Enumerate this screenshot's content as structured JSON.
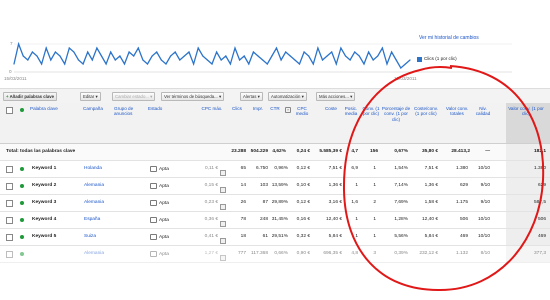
{
  "chart": {
    "y_top_label": "7",
    "y_bottom_label": "0",
    "date_start": "15/03/2011",
    "date_end": "15/03/2011",
    "history_link": "Ver mi historial de cambios",
    "legend_label": "Clics (1 por clic)",
    "line_color": "#2c74c9"
  },
  "chart_data": {
    "type": "line",
    "series": [
      {
        "name": "Clics (1 por clic)",
        "values": [
          2,
          7,
          4,
          3,
          5,
          4,
          2,
          6,
          3,
          5,
          4,
          2,
          6,
          5,
          3,
          2,
          5,
          3,
          6,
          4,
          2,
          5,
          3,
          4,
          2,
          5,
          4,
          6,
          3,
          2,
          4,
          5,
          3,
          2,
          4,
          5,
          3,
          4,
          5,
          2,
          6,
          4,
          3,
          2,
          5,
          3,
          4,
          2,
          6,
          3,
          4,
          2,
          5,
          4,
          3,
          2,
          4,
          6,
          3,
          5,
          4,
          3,
          2,
          5,
          4,
          2,
          6,
          3,
          4,
          5,
          2,
          6,
          4,
          3,
          5,
          4,
          2,
          5,
          3,
          4,
          6,
          2,
          5,
          3,
          1,
          2,
          3
        ]
      }
    ],
    "ylim": [
      0,
      7
    ],
    "xlabel": "",
    "ylabel": ""
  },
  "toolbar": {
    "add_keywords": "Añadir palabras clave",
    "edit": "Editar",
    "change_status": "Cambiar estado...",
    "search_terms": "Ver términos de búsqueda...",
    "alerts": "Alertas",
    "automation": "Automatización",
    "more_actions": "Más acciones..."
  },
  "columns": {
    "keyword": "Palabra clave",
    "campaign": "Campaña",
    "ad_group": "Grupo de anuncios",
    "status": "Estado",
    "max_cpc": "CPC máx.",
    "clicks": "Clics",
    "impr": "Impr.",
    "ctr": "CTR",
    "avg_cpc": "CPC medio",
    "cost": "Coste",
    "avg_pos": "Posic. media",
    "conv": "Conv. (1 por clic)",
    "conv_rate": "Porcentaje de conv. (1 por clic)",
    "cost_conv": "Coste/conv. (1 por clic)",
    "total_conv_value": "Valor conv. totales",
    "quality": "Niv. calidad",
    "conv_value": "Valor conv. (1 por clic)"
  },
  "total_row": {
    "label": "Total: todas las palabras clave",
    "clicks": "23.288",
    "impr": "504.229",
    "ctr": "4,62%",
    "avg_cpc": "0,24 €",
    "cost": "5.585,39 €",
    "avg_pos": "4,7",
    "conv": "156",
    "conv_rate": "0,67%",
    "cost_conv": "35,80 €",
    "total_conv_value": "28.413,2",
    "quality": "—",
    "conv_value": "182,1"
  },
  "rows": [
    {
      "keyword": "Keyword 1",
      "campaign": "Holanda",
      "status": "Apta",
      "max_cpc": "0,11 €",
      "clicks": "65",
      "impr": "6.750",
      "ctr": "0,96%",
      "avg_cpc": "0,12 €",
      "cost": "7,51 €",
      "avg_pos": "6,9",
      "conv": "1",
      "conv_rate": "1,54%",
      "cost_conv": "7,51 €",
      "total_conv_value": "1.380",
      "quality": "10/10",
      "conv_value": "1.380"
    },
    {
      "keyword": "Keyword 2",
      "campaign": "Alemania",
      "status": "Apta",
      "max_cpc": "0,15 €",
      "clicks": "14",
      "impr": "103",
      "ctr": "13,59%",
      "avg_cpc": "0,10 €",
      "cost": "1,36 €",
      "avg_pos": "1",
      "conv": "1",
      "conv_rate": "7,14%",
      "cost_conv": "1,36 €",
      "total_conv_value": "629",
      "quality": "9/10",
      "conv_value": "629"
    },
    {
      "keyword": "Keyword 3",
      "campaign": "Alemania",
      "status": "Apta",
      "max_cpc": "0,23 €",
      "clicks": "26",
      "impr": "87",
      "ctr": "29,89%",
      "avg_cpc": "0,12 €",
      "cost": "3,16 €",
      "avg_pos": "1,6",
      "conv": "2",
      "conv_rate": "7,69%",
      "cost_conv": "1,58 €",
      "total_conv_value": "1.175",
      "quality": "9/10",
      "conv_value": "587,5"
    },
    {
      "keyword": "Keyword 4",
      "campaign": "España",
      "status": "Apta",
      "max_cpc": "0,36 €",
      "clicks": "78",
      "impr": "248",
      "ctr": "31,45%",
      "avg_cpc": "0,16 €",
      "cost": "12,40 €",
      "avg_pos": "1",
      "conv": "1",
      "conv_rate": "1,28%",
      "cost_conv": "12,40 €",
      "total_conv_value": "506",
      "quality": "10/10",
      "conv_value": "506"
    },
    {
      "keyword": "Keyword 5",
      "campaign": "Suiza",
      "status": "Apta",
      "max_cpc": "0,41 €",
      "clicks": "18",
      "impr": "61",
      "ctr": "29,51%",
      "avg_cpc": "0,32 €",
      "cost": "5,84 €",
      "avg_pos": "1",
      "conv": "1",
      "conv_rate": "5,56%",
      "cost_conv": "5,84 €",
      "total_conv_value": "469",
      "quality": "10/10",
      "conv_value": "469"
    },
    {
      "keyword": "",
      "campaign": "Alemania",
      "status": "Apta",
      "max_cpc": "1,27 €",
      "clicks": "777",
      "impr": "117.368",
      "ctr": "0,66%",
      "avg_cpc": "0,90 €",
      "cost": "696,35 €",
      "avg_pos": "4,8",
      "conv": "3",
      "conv_rate": "0,39%",
      "cost_conv": "232,12 €",
      "total_conv_value": "1.132",
      "quality": "8/10",
      "conv_value": "377,3"
    }
  ],
  "annotation": {
    "circle_color": "#e01818"
  }
}
